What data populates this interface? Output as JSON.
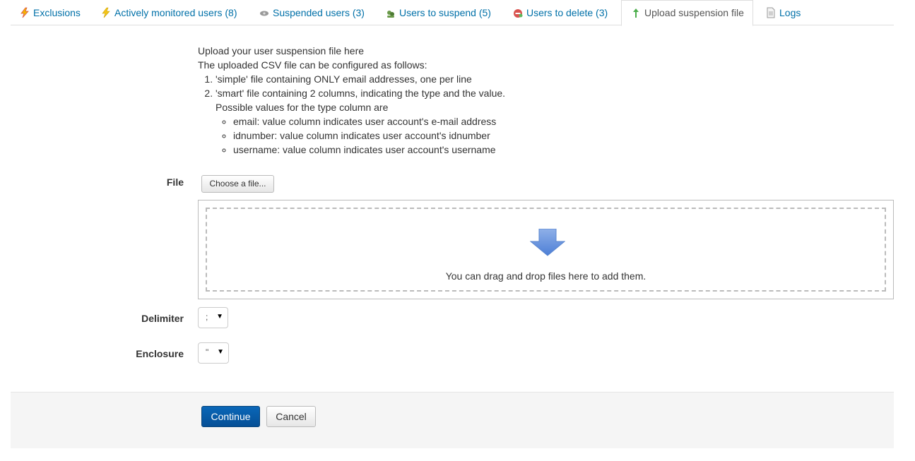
{
  "tabs": [
    {
      "label": "Exclusions",
      "icon": "lightning-icon"
    },
    {
      "label": "Actively monitored users (8)",
      "icon": "lightning-icon"
    },
    {
      "label": "Suspended users (3)",
      "icon": "eye-icon"
    },
    {
      "label": "Users to suspend (5)",
      "icon": "users-icon"
    },
    {
      "label": "Users to delete (3)",
      "icon": "delete-icon"
    },
    {
      "label": "Upload suspension file",
      "icon": "upload-arrow-icon",
      "active": true
    },
    {
      "label": "Logs",
      "icon": "document-icon"
    }
  ],
  "intro": {
    "line1": "Upload your user suspension file here",
    "line2": "The uploaded CSV file can be configured as follows:",
    "item1": "'simple' file containing ONLY email addresses, one per line",
    "item2": "'smart' file containing 2 columns, indicating the type and the value.",
    "item2_sub": "Possible values for the type column are",
    "values": [
      "email: value column indicates user account's e-mail address",
      "idnumber: value column indicates user account's idnumber",
      "username: value column indicates user account's username"
    ]
  },
  "form": {
    "file_label": "File",
    "choose_button": "Choose a file...",
    "drop_text": "You can drag and drop files here to add them.",
    "delimiter_label": "Delimiter",
    "delimiter_value": ";",
    "enclosure_label": "Enclosure",
    "enclosure_value": "\""
  },
  "actions": {
    "continue": "Continue",
    "cancel": "Cancel"
  },
  "colors": {
    "link": "#0070a8",
    "primary": "#0a67b8"
  }
}
